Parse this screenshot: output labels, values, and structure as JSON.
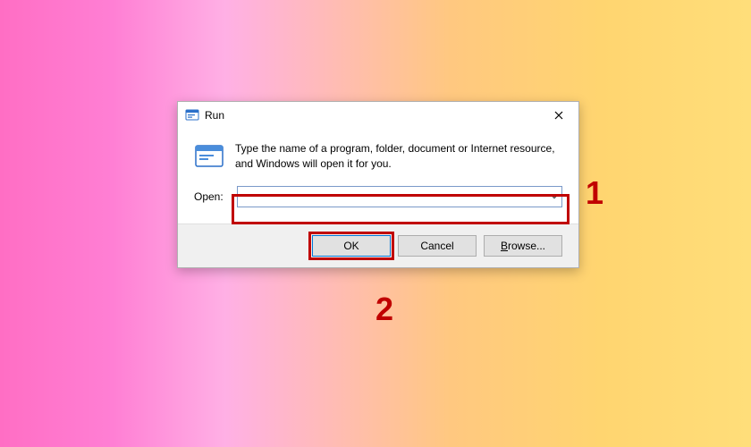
{
  "dialog": {
    "title": "Run",
    "description": "Type the name of a program, folder, document or Internet resource, and Windows will open it for you.",
    "open_label": "Open:",
    "open_value": "",
    "buttons": {
      "ok": "OK",
      "cancel": "Cancel",
      "browse": "Browse..."
    }
  },
  "annotations": {
    "step1": "1",
    "step2": "2"
  }
}
